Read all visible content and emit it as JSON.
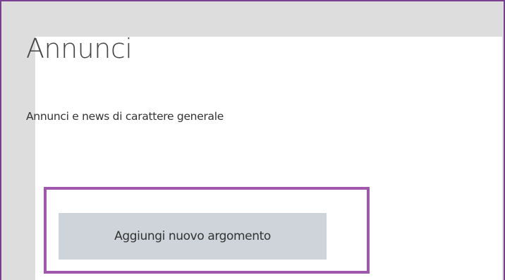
{
  "forum": {
    "title": "Annunci",
    "description": "Annunci e news di carattere generale",
    "add_topic_label": "Aggiungi nuovo argomento"
  },
  "colors": {
    "highlight": "#a058ad",
    "frame_border": "#7a3f8f",
    "button_bg": "#ced4da",
    "outer_bg": "#dddddd"
  }
}
